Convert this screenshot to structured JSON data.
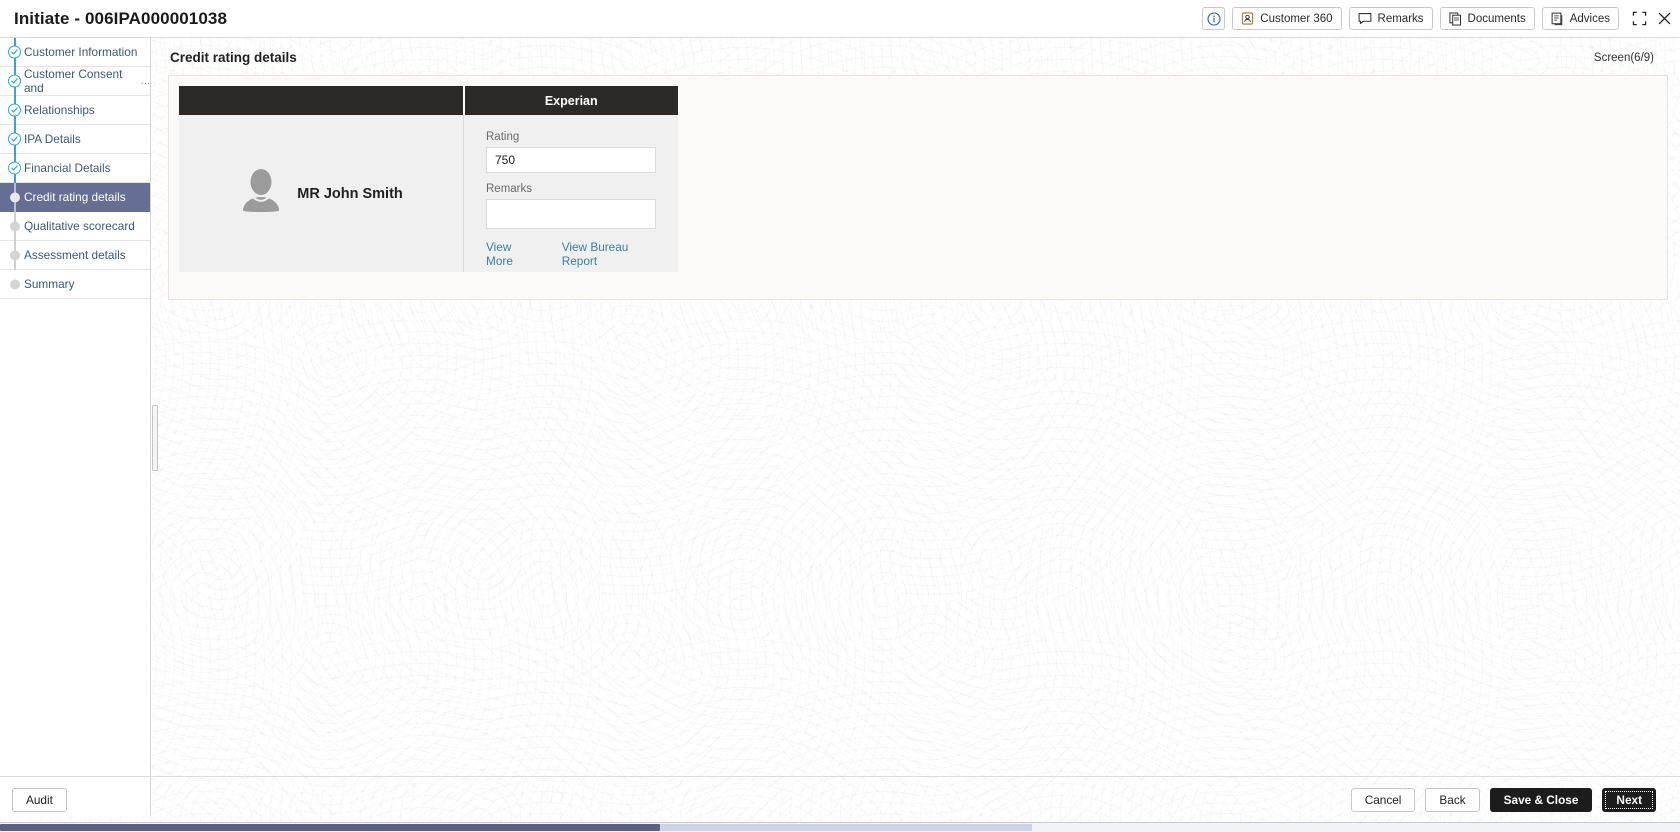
{
  "window": {
    "title": "Initiate - 006IPA000001038",
    "actions": [
      {
        "name": "info-button",
        "label": "",
        "icon": "info-icon",
        "icon_only": true
      },
      {
        "name": "customer-360-button",
        "label": "Customer 360",
        "icon": "person-card-icon",
        "icon_only": false
      },
      {
        "name": "remarks-button",
        "label": "Remarks",
        "icon": "speech-bubble-icon",
        "icon_only": false
      },
      {
        "name": "documents-button",
        "label": "Documents",
        "icon": "documents-icon",
        "icon_only": false
      },
      {
        "name": "advices-button",
        "label": "Advices",
        "icon": "advices-icon",
        "icon_only": false
      }
    ],
    "controls": [
      {
        "name": "collapse-button",
        "icon": "collapse-arrows-icon"
      },
      {
        "name": "close-button",
        "icon": "close-icon"
      }
    ]
  },
  "sidebar": {
    "items": [
      {
        "label": "Customer Information",
        "state": "completed",
        "truncated": false
      },
      {
        "label": "Customer Consent and",
        "state": "completed",
        "truncated": true,
        "ellipsis": "..."
      },
      {
        "label": "Relationships",
        "state": "completed",
        "truncated": false
      },
      {
        "label": "IPA Details",
        "state": "completed",
        "truncated": false
      },
      {
        "label": "Financial Details",
        "state": "completed",
        "truncated": false
      },
      {
        "label": "Credit rating details",
        "state": "active",
        "truncated": false
      },
      {
        "label": "Qualitative scorecard",
        "state": "pending",
        "truncated": false
      },
      {
        "label": "Assessment details",
        "state": "pending",
        "truncated": false
      },
      {
        "label": "Summary",
        "state": "pending",
        "truncated": false
      }
    ]
  },
  "main": {
    "page_title": "Credit rating details",
    "screen_counter": "Screen(6/9)",
    "bureau_table": {
      "header_blank": "",
      "header_bureau": "Experian",
      "customer_name": "MR John Smith",
      "avatar_icon": "person-avatar-icon",
      "fields": [
        {
          "name": "rating-field",
          "label": "Rating",
          "value": "750",
          "placeholder": ""
        },
        {
          "name": "remarks-field",
          "label": "Remarks",
          "value": "",
          "placeholder": ""
        }
      ],
      "links": [
        {
          "name": "view-more-link",
          "label": "View More"
        },
        {
          "name": "view-bureau-report-link",
          "label": "View Bureau Report"
        }
      ]
    }
  },
  "footer": {
    "audit_label": "Audit",
    "cancel_label": "Cancel",
    "back_label": "Back",
    "save_close_label": "Save & Close",
    "next_label": "Next"
  },
  "colors": {
    "active_nav": "#666e94",
    "table_header": "#2d2926",
    "link": "#3b7f9e",
    "nav_text": "#3d5a70",
    "check_blue": "#2fa7d8",
    "primary_button": "#1c1c1c"
  }
}
